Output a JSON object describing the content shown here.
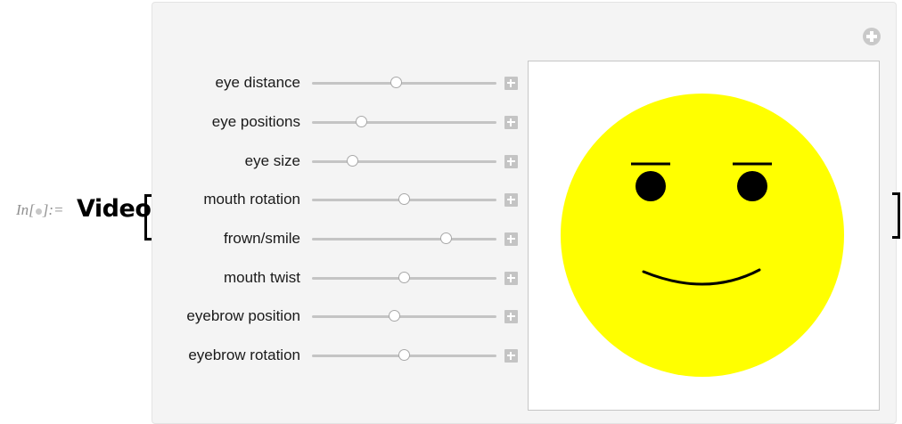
{
  "input_label": {
    "prefix": "In[",
    "suffix": "]:="
  },
  "function_name": "Video",
  "controls": [
    {
      "label": "eye distance",
      "value": 0.46
    },
    {
      "label": "eye positions",
      "value": 0.27
    },
    {
      "label": "eye size",
      "value": 0.22
    },
    {
      "label": "mouth rotation",
      "value": 0.5
    },
    {
      "label": "frown/smile",
      "value": 0.73
    },
    {
      "label": "mouth twist",
      "value": 0.5
    },
    {
      "label": "eyebrow position",
      "value": 0.45
    },
    {
      "label": "eyebrow rotation",
      "value": 0.5
    }
  ],
  "colors": {
    "face": "#ffff00",
    "features": "#000000"
  },
  "icons": {
    "panel_options": "plus-circle-icon",
    "control_expand": "plus-box-icon"
  }
}
